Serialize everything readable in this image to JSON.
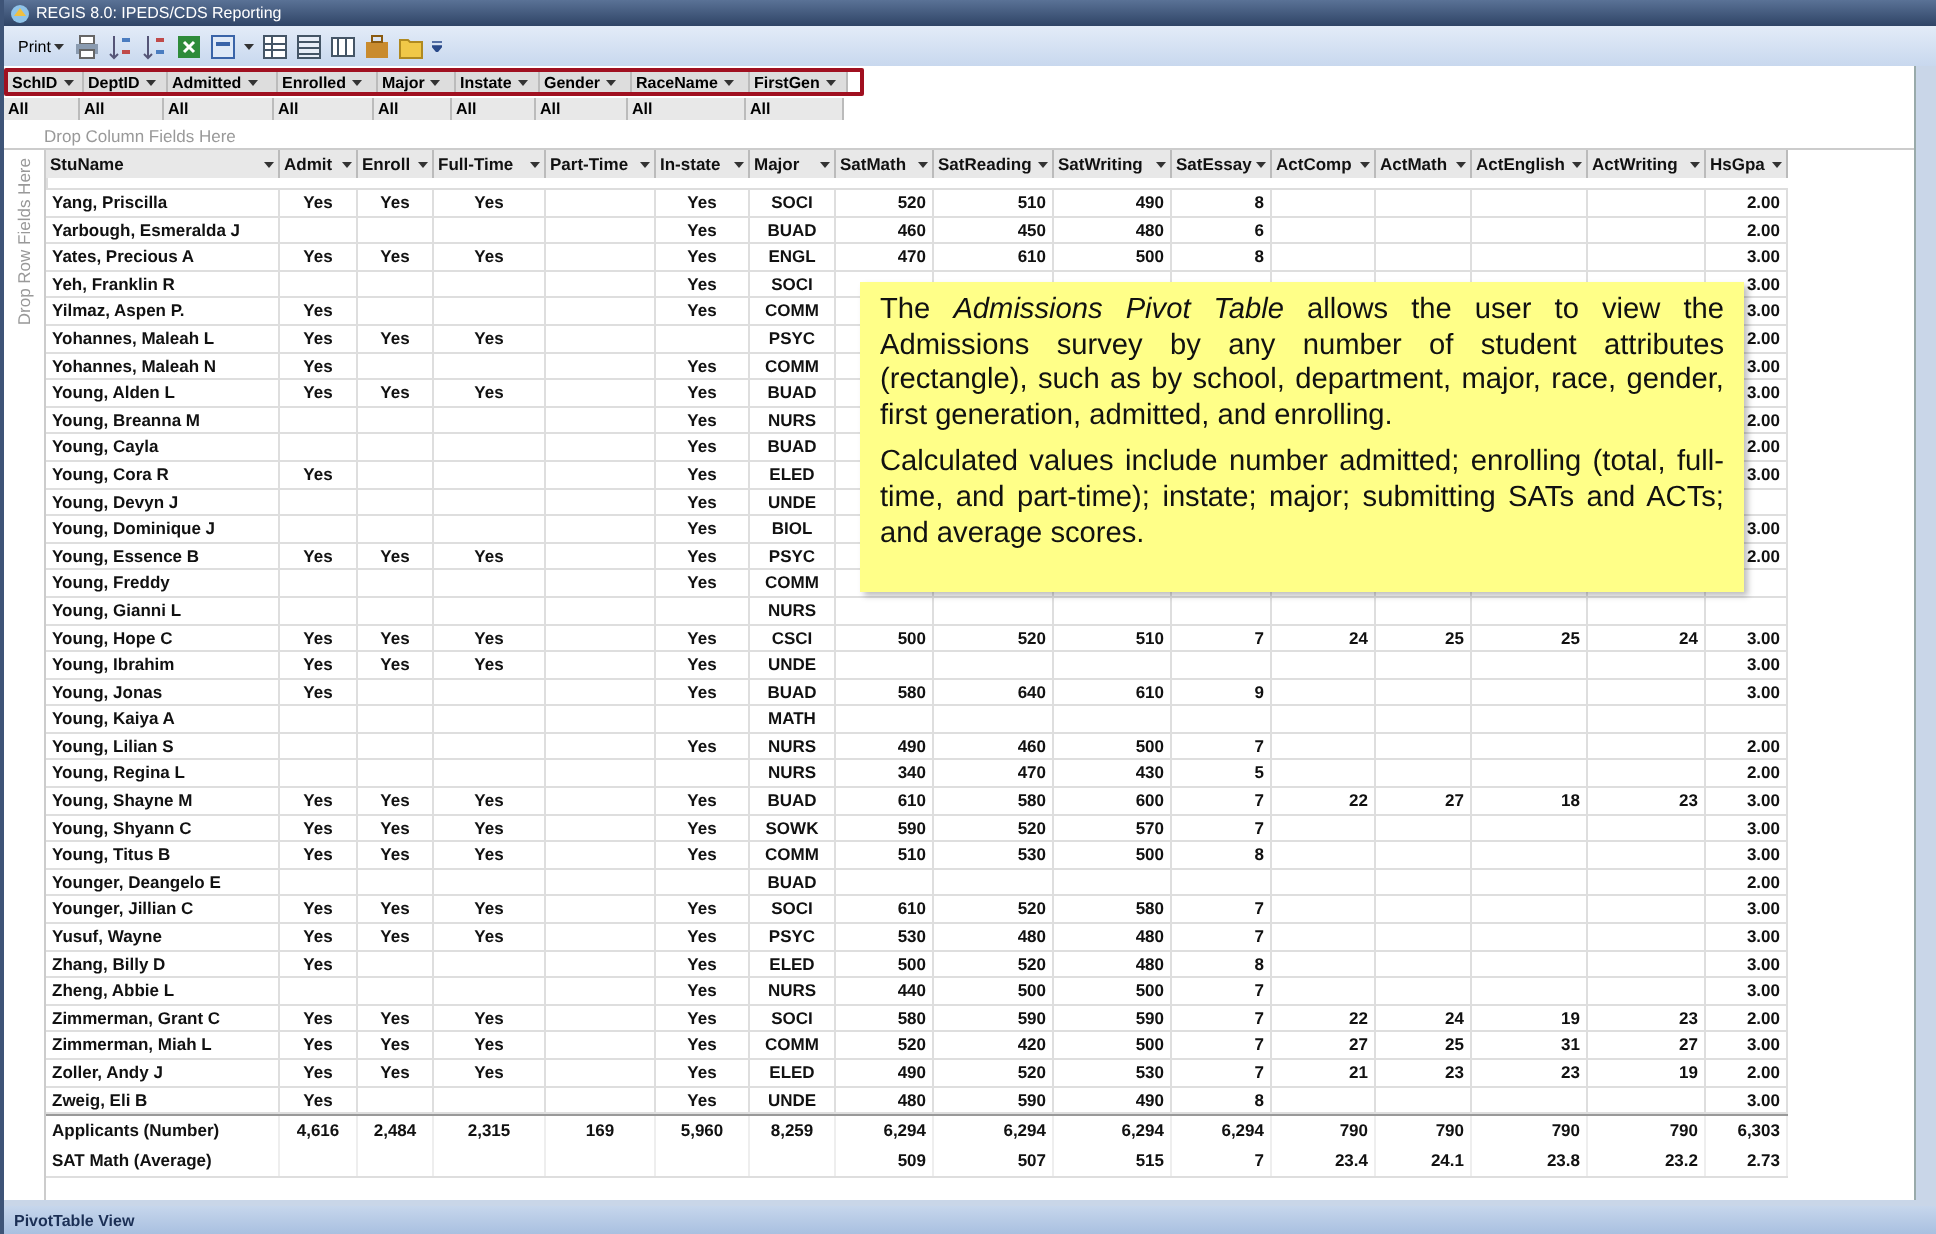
{
  "window": {
    "title": "REGIS 8.0:  IPEDS/CDS Reporting"
  },
  "toolbar": {
    "print_label": "Print"
  },
  "filters": [
    {
      "label": "SchID",
      "value": "All"
    },
    {
      "label": "DeptID",
      "value": "All"
    },
    {
      "label": "Admitted",
      "value": "All"
    },
    {
      "label": "Enrolled",
      "value": "All"
    },
    {
      "label": "Major",
      "value": "All"
    },
    {
      "label": "Instate",
      "value": "All"
    },
    {
      "label": "Gender",
      "value": "All"
    },
    {
      "label": "RaceName",
      "value": "All"
    },
    {
      "label": "FirstGen",
      "value": "All"
    }
  ],
  "drop_column_hint": "Drop Column Fields Here",
  "drop_row_hint": "Drop Row Fields Here",
  "table": {
    "columns": [
      "StuName",
      "Admit",
      "Enroll",
      "Full-Time",
      "Part-Time",
      "In-state",
      "Major",
      "SatMath",
      "SatReading",
      "SatWriting",
      "SatEssay",
      "ActComp",
      "ActMath",
      "ActEnglish",
      "ActWriting",
      "HsGpa"
    ],
    "rows": [
      [
        "Yang, Priscilla",
        "Yes",
        "Yes",
        "Yes",
        null,
        "Yes",
        "SOCI",
        "520",
        "510",
        "490",
        "8",
        null,
        null,
        null,
        null,
        "2.00"
      ],
      [
        "Yarbough, Esmeralda J",
        null,
        null,
        null,
        null,
        "Yes",
        "BUAD",
        "460",
        "450",
        "480",
        "6",
        null,
        null,
        null,
        null,
        "2.00"
      ],
      [
        "Yates, Precious A",
        "Yes",
        "Yes",
        "Yes",
        null,
        "Yes",
        "ENGL",
        "470",
        "610",
        "500",
        "8",
        null,
        null,
        null,
        null,
        "3.00"
      ],
      [
        "Yeh, Franklin R",
        null,
        null,
        null,
        null,
        "Yes",
        "SOCI",
        null,
        null,
        null,
        null,
        null,
        null,
        null,
        null,
        "3.00"
      ],
      [
        "Yilmaz, Aspen P.",
        "Yes",
        null,
        null,
        null,
        "Yes",
        "COMM",
        null,
        null,
        null,
        null,
        null,
        null,
        null,
        null,
        "3.00"
      ],
      [
        "Yohannes, Maleah L",
        "Yes",
        "Yes",
        "Yes",
        null,
        null,
        "PSYC",
        null,
        null,
        null,
        null,
        null,
        null,
        null,
        null,
        "2.00"
      ],
      [
        "Yohannes, Maleah N",
        "Yes",
        null,
        null,
        null,
        "Yes",
        "COMM",
        null,
        null,
        null,
        null,
        null,
        null,
        null,
        null,
        "3.00"
      ],
      [
        "Young, Alden L",
        "Yes",
        "Yes",
        "Yes",
        null,
        "Yes",
        "BUAD",
        null,
        null,
        null,
        null,
        null,
        null,
        null,
        null,
        "3.00"
      ],
      [
        "Young, Breanna M",
        null,
        null,
        null,
        null,
        "Yes",
        "NURS",
        null,
        null,
        null,
        null,
        null,
        null,
        null,
        null,
        "2.00"
      ],
      [
        "Young, Cayla",
        null,
        null,
        null,
        null,
        "Yes",
        "BUAD",
        null,
        null,
        null,
        null,
        null,
        null,
        null,
        null,
        "2.00"
      ],
      [
        "Young, Cora R",
        "Yes",
        null,
        null,
        null,
        "Yes",
        "ELED",
        null,
        null,
        null,
        null,
        null,
        null,
        null,
        null,
        "3.00"
      ],
      [
        "Young, Devyn J",
        null,
        null,
        null,
        null,
        "Yes",
        "UNDE",
        null,
        null,
        null,
        null,
        null,
        null,
        null,
        null,
        null
      ],
      [
        "Young, Dominique J",
        null,
        null,
        null,
        null,
        "Yes",
        "BIOL",
        null,
        null,
        null,
        null,
        null,
        null,
        null,
        null,
        "3.00"
      ],
      [
        "Young, Essence B",
        "Yes",
        "Yes",
        "Yes",
        null,
        "Yes",
        "PSYC",
        null,
        null,
        null,
        null,
        null,
        null,
        null,
        null,
        "2.00"
      ],
      [
        "Young, Freddy",
        null,
        null,
        null,
        null,
        "Yes",
        "COMM",
        null,
        null,
        null,
        null,
        null,
        null,
        null,
        null,
        null
      ],
      [
        "Young, Gianni L",
        null,
        null,
        null,
        null,
        null,
        "NURS",
        null,
        null,
        null,
        null,
        null,
        null,
        null,
        null,
        null
      ],
      [
        "Young, Hope C",
        "Yes",
        "Yes",
        "Yes",
        null,
        "Yes",
        "CSCI",
        "500",
        "520",
        "510",
        "7",
        "24",
        "25",
        "25",
        "24",
        "3.00"
      ],
      [
        "Young, Ibrahim",
        "Yes",
        "Yes",
        "Yes",
        null,
        "Yes",
        "UNDE",
        null,
        null,
        null,
        null,
        null,
        null,
        null,
        null,
        "3.00"
      ],
      [
        "Young, Jonas",
        "Yes",
        null,
        null,
        null,
        "Yes",
        "BUAD",
        "580",
        "640",
        "610",
        "9",
        null,
        null,
        null,
        null,
        "3.00"
      ],
      [
        "Young, Kaiya A",
        null,
        null,
        null,
        null,
        null,
        "MATH",
        null,
        null,
        null,
        null,
        null,
        null,
        null,
        null,
        null
      ],
      [
        "Young, Lilian S",
        null,
        null,
        null,
        null,
        "Yes",
        "NURS",
        "490",
        "460",
        "500",
        "7",
        null,
        null,
        null,
        null,
        "2.00"
      ],
      [
        "Young, Regina L",
        null,
        null,
        null,
        null,
        null,
        "NURS",
        "340",
        "470",
        "430",
        "5",
        null,
        null,
        null,
        null,
        "2.00"
      ],
      [
        "Young, Shayne M",
        "Yes",
        "Yes",
        "Yes",
        null,
        "Yes",
        "BUAD",
        "610",
        "580",
        "600",
        "7",
        "22",
        "27",
        "18",
        "23",
        "3.00"
      ],
      [
        "Young, Shyann C",
        "Yes",
        "Yes",
        "Yes",
        null,
        "Yes",
        "SOWK",
        "590",
        "520",
        "570",
        "7",
        null,
        null,
        null,
        null,
        "3.00"
      ],
      [
        "Young, Titus B",
        "Yes",
        "Yes",
        "Yes",
        null,
        "Yes",
        "COMM",
        "510",
        "530",
        "500",
        "8",
        null,
        null,
        null,
        null,
        "3.00"
      ],
      [
        "Younger, Deangelo E",
        null,
        null,
        null,
        null,
        null,
        "BUAD",
        null,
        null,
        null,
        null,
        null,
        null,
        null,
        null,
        "2.00"
      ],
      [
        "Younger, Jillian C",
        "Yes",
        "Yes",
        "Yes",
        null,
        "Yes",
        "SOCI",
        "610",
        "520",
        "580",
        "7",
        null,
        null,
        null,
        null,
        "3.00"
      ],
      [
        "Yusuf, Wayne",
        "Yes",
        "Yes",
        "Yes",
        null,
        "Yes",
        "PSYC",
        "530",
        "480",
        "480",
        "7",
        null,
        null,
        null,
        null,
        "3.00"
      ],
      [
        "Zhang, Billy D",
        "Yes",
        null,
        null,
        null,
        "Yes",
        "ELED",
        "500",
        "520",
        "480",
        "8",
        null,
        null,
        null,
        null,
        "3.00"
      ],
      [
        "Zheng, Abbie L",
        null,
        null,
        null,
        null,
        "Yes",
        "NURS",
        "440",
        "500",
        "500",
        "7",
        null,
        null,
        null,
        null,
        "3.00"
      ],
      [
        "Zimmerman, Grant C",
        "Yes",
        "Yes",
        "Yes",
        null,
        "Yes",
        "SOCI",
        "580",
        "590",
        "590",
        "7",
        "22",
        "24",
        "19",
        "23",
        "2.00"
      ],
      [
        "Zimmerman, Miah L",
        "Yes",
        "Yes",
        "Yes",
        null,
        "Yes",
        "COMM",
        "520",
        "420",
        "500",
        "7",
        "27",
        "25",
        "31",
        "27",
        "3.00"
      ],
      [
        "Zoller, Andy J",
        "Yes",
        "Yes",
        "Yes",
        null,
        "Yes",
        "ELED",
        "490",
        "520",
        "530",
        "7",
        "21",
        "23",
        "23",
        "19",
        "2.00"
      ],
      [
        "Zweig, Eli B",
        "Yes",
        null,
        null,
        null,
        "Yes",
        "UNDE",
        "480",
        "590",
        "490",
        "8",
        null,
        null,
        null,
        null,
        "3.00"
      ]
    ],
    "summary_rows": [
      [
        "Applicants (Number)",
        "4,616",
        "2,484",
        "2,315",
        "169",
        "5,960",
        "8,259",
        "6,294",
        "6,294",
        "6,294",
        "6,294",
        "790",
        "790",
        "790",
        "790",
        "6,303"
      ],
      [
        "SAT Math (Average)",
        null,
        null,
        null,
        null,
        null,
        null,
        "509",
        "507",
        "515",
        "7",
        "23.4",
        "24.1",
        "23.8",
        "23.2",
        "2.73"
      ]
    ]
  },
  "callout": {
    "paragraphs": [
      "The *Admissions Pivot Table* allows the user to view the Admissions survey by any number of student attributes (rectangle), such as by school, department, major, race, gender, first generation, admitted, and enrolling.",
      "Calculated values include number admitted; enrolling (total, full-time, and part-time); instate; major; submitting SATs and ACTs; and average scores."
    ]
  },
  "status_bar": {
    "text": "PivotTable View"
  }
}
